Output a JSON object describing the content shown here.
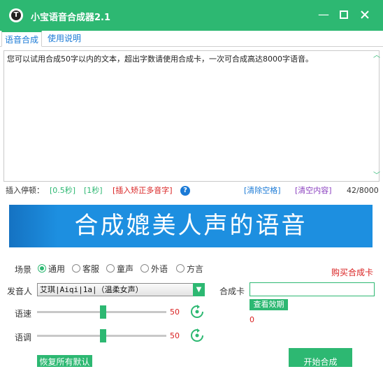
{
  "window": {
    "title": "小宝语音合成器2.1",
    "app_icon_letter": "T"
  },
  "tabs": [
    {
      "label": "语音合成",
      "active": true
    },
    {
      "label": "使用说明",
      "active": false
    }
  ],
  "editor": {
    "text": "您可以试用合成50字以内的文本，超出字数请使用合成卡，一次可合成高达8000字语音。"
  },
  "insert_bar": {
    "label": "插入停顿：",
    "pause_half": "[0.5秒]",
    "pause_one": "[1秒]",
    "polyphone": "[插入矫正多音字]",
    "clear_spaces": "[清除空格]",
    "clear_content": "[清空内容]",
    "char_count": "42/8000"
  },
  "banner": {
    "text": "合成媲美人声的语音"
  },
  "scene": {
    "label": "场景",
    "options": [
      "通用",
      "客服",
      "童声",
      "外语",
      "方言"
    ],
    "selected": "通用"
  },
  "buy_card": "购买合成卡",
  "speaker": {
    "label": "发音人",
    "value": "艾琪|Aiqi|1a|（温柔女声）"
  },
  "card": {
    "label": "合成卡",
    "value": "",
    "check_label": "查看效期",
    "remaining": "0"
  },
  "speed": {
    "label": "语速",
    "value": "50",
    "level": 0.5
  },
  "pitch": {
    "label": "语调",
    "value": "50",
    "level": 0.5
  },
  "buttons": {
    "reset": "恢复所有默认",
    "start": "开始合成"
  },
  "colors": {
    "accent": "#2db872",
    "link": "#1a7ad6",
    "alert": "#d92020",
    "banner": "#1d8fe0"
  }
}
